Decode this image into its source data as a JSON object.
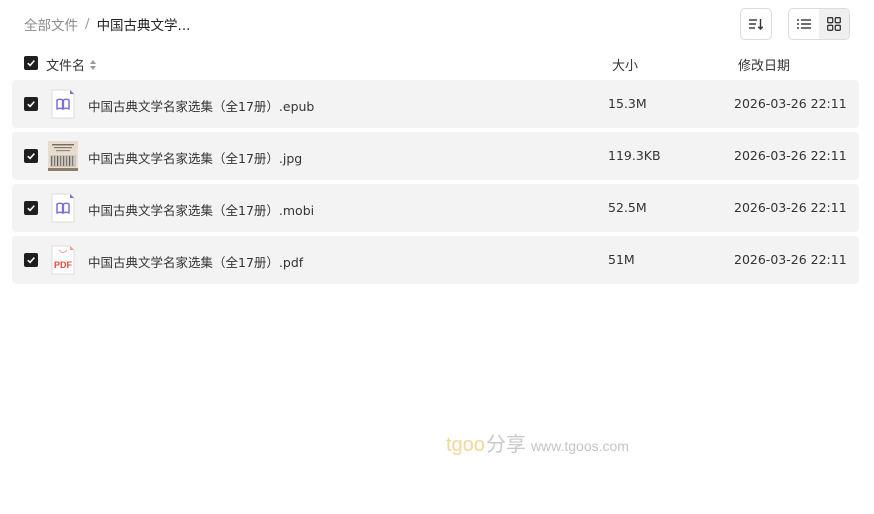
{
  "breadcrumb": {
    "root": "全部文件",
    "separator": "/",
    "current": "中国古典文学..."
  },
  "toolbar": {
    "sort_icon": "sort-icon",
    "view_list_icon": "list-view-icon",
    "view_grid_icon": "grid-view-icon",
    "active_view": "grid"
  },
  "table": {
    "columns": {
      "name": "文件名",
      "size": "大小",
      "date": "修改日期"
    },
    "select_all_checked": true,
    "rows": [
      {
        "icon": "ebook-icon",
        "name": "中国古典文学名家选集（全17册）.epub",
        "size": "15.3M",
        "date": "2026-03-26 22:11",
        "checked": true
      },
      {
        "icon": "image-thumbnail",
        "name": "中国古典文学名家选集（全17册）.jpg",
        "size": "119.3KB",
        "date": "2026-03-26 22:11",
        "checked": true
      },
      {
        "icon": "ebook-icon",
        "name": "中国古典文学名家选集（全17册）.mobi",
        "size": "52.5M",
        "date": "2026-03-26 22:11",
        "checked": true
      },
      {
        "icon": "pdf-icon",
        "name": "中国古典文学名家选集（全17册）.pdf",
        "size": "51M",
        "date": "2026-03-26 22:11",
        "checked": true
      }
    ]
  },
  "watermark": {
    "brand": "tgoo",
    "brand_cn": "分享",
    "url": "www.tgoos.com"
  },
  "colors": {
    "row_bg": "#f3f3f3",
    "ebook_accent": "#7b6fd6",
    "pdf_accent": "#e8473c",
    "watermark_brand": "#f3d69a"
  }
}
